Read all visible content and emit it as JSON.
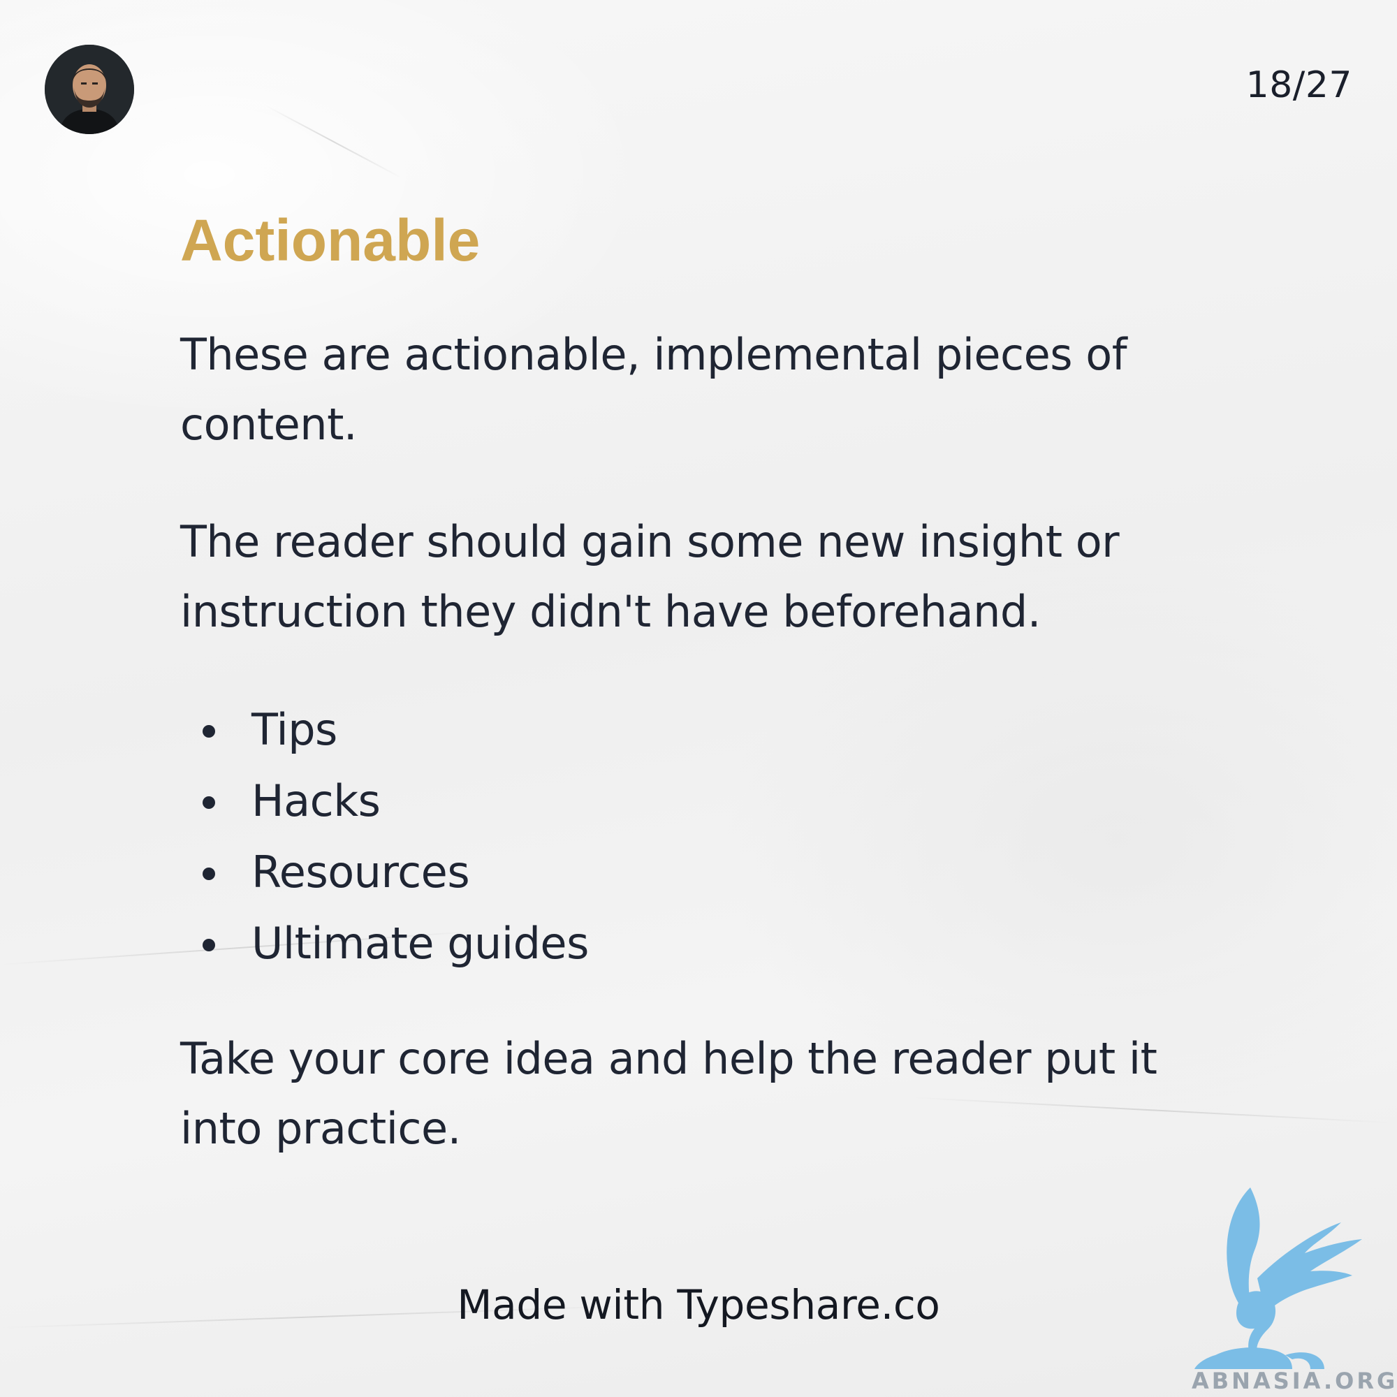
{
  "page_counter": "18/27",
  "heading": "Actionable",
  "paragraphs": {
    "intro": "These are actionable, implemental pieces of content.",
    "second": "The reader should gain some new insight or instruction they didn't have beforehand.",
    "closing": "Take your core idea and help the reader put it into practice."
  },
  "list_items": [
    "Tips",
    "Hacks",
    "Resources",
    "Ultimate guides"
  ],
  "footer": "Made with Typeshare.co",
  "watermark": {
    "text": "ABNASIA.ORG",
    "icon": "griffin-logo-icon"
  },
  "colors": {
    "heading_accent": "#cfa652",
    "body_text": "#1f2533",
    "watermark_blue": "#7bbde6"
  },
  "icons": {
    "avatar": "author-avatar-photo",
    "bullet": "bullet-dot-icon"
  }
}
